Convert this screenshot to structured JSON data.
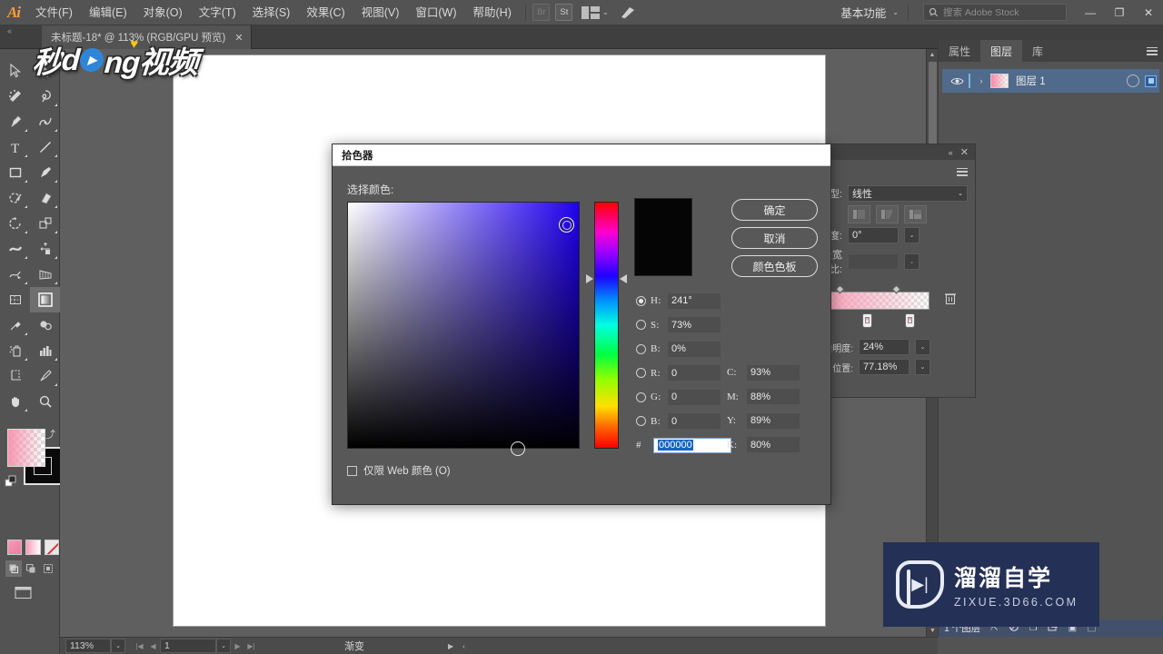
{
  "app": {
    "name": "Ai",
    "logo_icon": "adobe-illustrator-logo"
  },
  "menubar": {
    "items": [
      {
        "label": "文件(F)"
      },
      {
        "label": "编辑(E)"
      },
      {
        "label": "对象(O)"
      },
      {
        "label": "文字(T)"
      },
      {
        "label": "选择(S)"
      },
      {
        "label": "效果(C)"
      },
      {
        "label": "视图(V)"
      },
      {
        "label": "窗口(W)"
      },
      {
        "label": "帮助(H)"
      }
    ],
    "bridge_badge": "Br",
    "stock_badge": "St",
    "arrange_icon": "arrange-documents-icon",
    "arrange_chevron": "⌄",
    "brush_icon": "brush-icon",
    "workspace_label": "基本功能",
    "workspace_chevron": "⌄",
    "search": {
      "icon": "search-icon",
      "placeholder": "搜索 Adobe Stock"
    },
    "window_controls": {
      "minimize": "—",
      "restore": "❐",
      "close": "✕"
    }
  },
  "tabbar": {
    "collapse_icon": "«",
    "document_tab": {
      "title": "未标题-18* @ 113% (RGB/GPU 预览)",
      "close": "✕"
    }
  },
  "toolbar": {
    "tools": [
      {
        "name": "selection-tool"
      },
      {
        "name": "direct-selection-tool"
      },
      {
        "name": "magic-wand-tool"
      },
      {
        "name": "lasso-tool"
      },
      {
        "name": "pen-tool"
      },
      {
        "name": "curvature-tool"
      },
      {
        "name": "type-tool"
      },
      {
        "name": "line-segment-tool"
      },
      {
        "name": "rectangle-tool"
      },
      {
        "name": "paintbrush-tool"
      },
      {
        "name": "shaper-tool"
      },
      {
        "name": "eraser-tool"
      },
      {
        "name": "rotate-tool"
      },
      {
        "name": "scale-tool"
      },
      {
        "name": "width-tool"
      },
      {
        "name": "free-transform-tool"
      },
      {
        "name": "shape-builder-tool"
      },
      {
        "name": "perspective-grid-tool"
      },
      {
        "name": "mesh-tool"
      },
      {
        "name": "gradient-tool"
      },
      {
        "name": "eyedropper-tool"
      },
      {
        "name": "blend-tool"
      },
      {
        "name": "symbol-sprayer-tool"
      },
      {
        "name": "column-graph-tool"
      },
      {
        "name": "artboard-tool"
      },
      {
        "name": "slice-tool"
      },
      {
        "name": "hand-tool"
      },
      {
        "name": "zoom-tool"
      }
    ],
    "selected_tool": "gradient-tool",
    "fill_swatch": {
      "name": "fill-color",
      "color": "#f6969f",
      "type": "gradient-pink-transparent"
    },
    "stroke_swatch": {
      "name": "stroke-color",
      "color": "#000000"
    },
    "swap_icon": "swap-fill-stroke-icon",
    "default_icon": "default-fill-stroke-icon",
    "color_modes": [
      {
        "name": "color-mode-button",
        "color": "#f07da3"
      },
      {
        "name": "gradient-mode-button",
        "color": "#f79cb8"
      },
      {
        "name": "none-mode-button",
        "color": "#e03131"
      }
    ],
    "draw_modes": [
      {
        "name": "draw-normal-button"
      },
      {
        "name": "draw-behind-button"
      },
      {
        "name": "draw-inside-button"
      }
    ],
    "screen_mode_icon": "change-screen-mode-icon"
  },
  "canvas": {
    "artboard_background": "#ffffff",
    "gradient_object": {
      "name": "pink-gradient-rectangle",
      "fill": "#f789ab"
    },
    "gradient_annotator": "gradient-annotator-handle",
    "scrollbar": {
      "up_arrow": "▲",
      "down_arrow": "▼"
    }
  },
  "statusbar": {
    "zoom_level": "113%",
    "zoom_chevron": "⌄",
    "nav_first": "|◀",
    "nav_prev": "◀",
    "page_value": "1",
    "page_chevron": "⌄",
    "nav_next": "▶",
    "nav_last": "▶|",
    "current_tool": "渐变",
    "arrow_right": "▶",
    "arrow_left": "‹"
  },
  "right_dock": {
    "tabs": [
      {
        "label": "属性",
        "active": false
      },
      {
        "label": "图层",
        "active": true
      },
      {
        "label": "库",
        "active": false
      }
    ],
    "panel_menu_icon": "panel-menu-icon",
    "layers": [
      {
        "visibility_icon": "eye-icon",
        "expand_icon": "›",
        "thumbnail": "layer-thumbnail-pink-gradient",
        "name": "图层 1",
        "target_icon": "target-circle-icon",
        "selection_indicator": "selection-square"
      }
    ],
    "footer": {
      "count_label": "1 个图层",
      "icons": [
        {
          "name": "locate-object-icon",
          "glyph": "⇱"
        },
        {
          "name": "make-clipping-mask-icon",
          "glyph": "◌"
        },
        {
          "name": "create-new-sublayer-icon",
          "glyph": "❐"
        },
        {
          "name": "create-new-layer-icon",
          "glyph": "⊞"
        },
        {
          "name": "duplicate-layer-icon",
          "glyph": "▣"
        },
        {
          "name": "delete-layer-icon",
          "glyph": "🗑"
        }
      ]
    }
  },
  "gradient_panel": {
    "collapse_icon": "«",
    "close_icon": "✕",
    "menu_icon": "panel-menu-icon",
    "type_label": "类型:",
    "type_value": "线性",
    "type_chevron": "⌄",
    "stroke_options": [
      {
        "name": "stroke-gradient-within-icon"
      },
      {
        "name": "stroke-gradient-along-icon"
      },
      {
        "name": "stroke-gradient-across-icon"
      }
    ],
    "angle_label": "角度:",
    "angle_value": "0°",
    "angle_chevron": "⌄",
    "aspect_label": "长宽比:",
    "aspect_value": "",
    "aspect_chevron": "⌄",
    "gradient_slider": {
      "name": "gradient-slider",
      "start_color": "#f58db0",
      "end_color": "#ffffff",
      "stops": [
        {
          "position": 24
        },
        {
          "position": 77
        }
      ]
    },
    "delete_stop_icon": "trash-icon",
    "opacity_label": "不透明度:",
    "opacity_value": "24%",
    "opacity_chevron": "⌄",
    "location_label": "位置:",
    "location_value": "77.18%",
    "location_chevron": "⌄"
  },
  "color_picker_dialog": {
    "title": "拾色器",
    "select_color_label": "选择颜色:",
    "color_field": {
      "name": "saturation-brightness-field",
      "marker_icon": "color-ring-marker",
      "bottom_marker_icon": "color-field-bottom-marker"
    },
    "hue_slider": {
      "name": "hue-slider",
      "left_marker": "hue-marker-left",
      "right_marker": "hue-marker-right"
    },
    "preview": {
      "new_color": "#000000",
      "current_color": "#000000"
    },
    "buttons": [
      {
        "name": "ok-button",
        "label": "确定"
      },
      {
        "name": "cancel-button",
        "label": "取消"
      },
      {
        "name": "color-swatches-button",
        "label": "颜色色板"
      }
    ],
    "hsb_rgb_fields": [
      {
        "key": "hsb-hue",
        "label": "H:",
        "value": "241°",
        "radio": true,
        "selected": true
      },
      {
        "key": "hsb-saturation",
        "label": "S:",
        "value": "73%",
        "radio": true,
        "selected": false
      },
      {
        "key": "hsb-brightness",
        "label": "B:",
        "value": "0%",
        "radio": true,
        "selected": false
      },
      {
        "key": "rgb-red",
        "label": "R:",
        "value": "0",
        "radio": true,
        "selected": false
      },
      {
        "key": "rgb-green",
        "label": "G:",
        "value": "0",
        "radio": true,
        "selected": false
      },
      {
        "key": "rgb-blue",
        "label": "B:",
        "value": "0",
        "radio": true,
        "selected": false
      }
    ],
    "hex": {
      "prefix": "#",
      "value": "000000"
    },
    "cmyk_fields": [
      {
        "key": "cmyk-cyan",
        "label": "C:",
        "value": "93%"
      },
      {
        "key": "cmyk-magenta",
        "label": "M:",
        "value": "88%"
      },
      {
        "key": "cmyk-yellow",
        "label": "Y:",
        "value": "89%"
      },
      {
        "key": "cmyk-black",
        "label": "K:",
        "value": "80%"
      }
    ],
    "web_only_checkbox": {
      "label": "仅限 Web 颜色 (O)",
      "checked": false
    }
  },
  "watermarks": {
    "top_left": {
      "text_before": "秒",
      "letter_d": "d",
      "play_icon": "▶",
      "text_after": "ng视频",
      "accent_color": "#2f86d6",
      "heart_icon": "♥"
    },
    "bottom_right": {
      "logo_icon": "play-logo-icon",
      "title": "溜溜自学",
      "url": "ZIXUE.3D66.COM",
      "background": "#243055"
    }
  }
}
